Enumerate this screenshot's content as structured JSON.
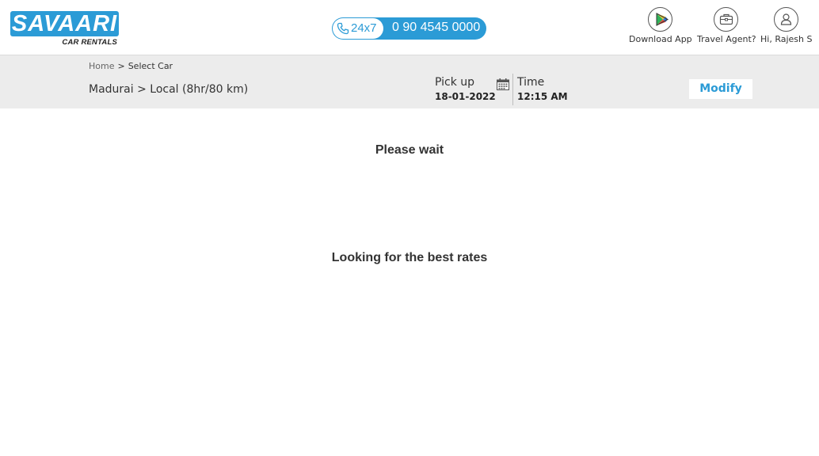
{
  "brand": {
    "name": "SAVAARI",
    "tagline": "CAR RENTALS",
    "color": "#2b9bd6"
  },
  "phone": {
    "icon": "phone-icon",
    "availability": "24x7",
    "number": "0 90 4545 0000"
  },
  "header_actions": [
    {
      "label": "Download App",
      "icon": "play-store-icon"
    },
    {
      "label": "Travel Agent?",
      "icon": "briefcase-icon"
    },
    {
      "label": "Hi, Rajesh S",
      "icon": "user-icon"
    }
  ],
  "breadcrumb": {
    "home": "Home",
    "separator": ">",
    "current": "Select Car"
  },
  "trip": {
    "route": "Madurai > Local (8hr/80 km)",
    "pickup_label": "Pick up",
    "pickup_date": "18-01-2022",
    "calendar_icon": "calendar-icon",
    "time_label": "Time",
    "time_value": "12:15 AM",
    "modify_label": "Modify"
  },
  "status": {
    "wait": "Please wait",
    "looking": "Looking for the best rates"
  }
}
